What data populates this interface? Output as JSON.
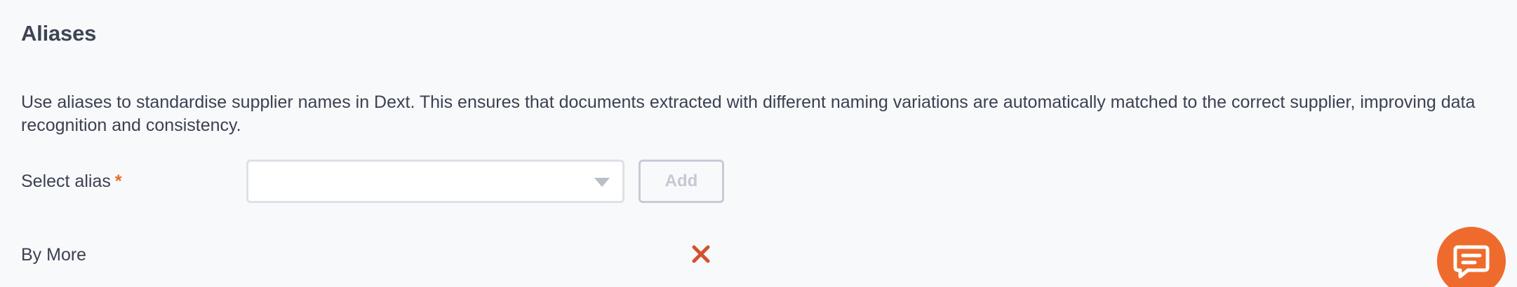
{
  "section": {
    "title": "Aliases",
    "description": "Use aliases to standardise supplier names in Dext. This ensures that documents extracted with different naming variations are automatically matched to the correct supplier, improving data recognition and consistency."
  },
  "alias_form": {
    "label": "Select alias",
    "required_marker": "*",
    "select_value": "",
    "add_label": "Add"
  },
  "aliases": [
    {
      "name": "By More"
    }
  ],
  "icons": {
    "remove": "close-icon",
    "chat": "chat-icon",
    "dropdown": "chevron-down-icon"
  },
  "colors": {
    "accent": "#ef6b2d",
    "remove": "#d2522b",
    "disabled_text": "#c4c9d2"
  }
}
